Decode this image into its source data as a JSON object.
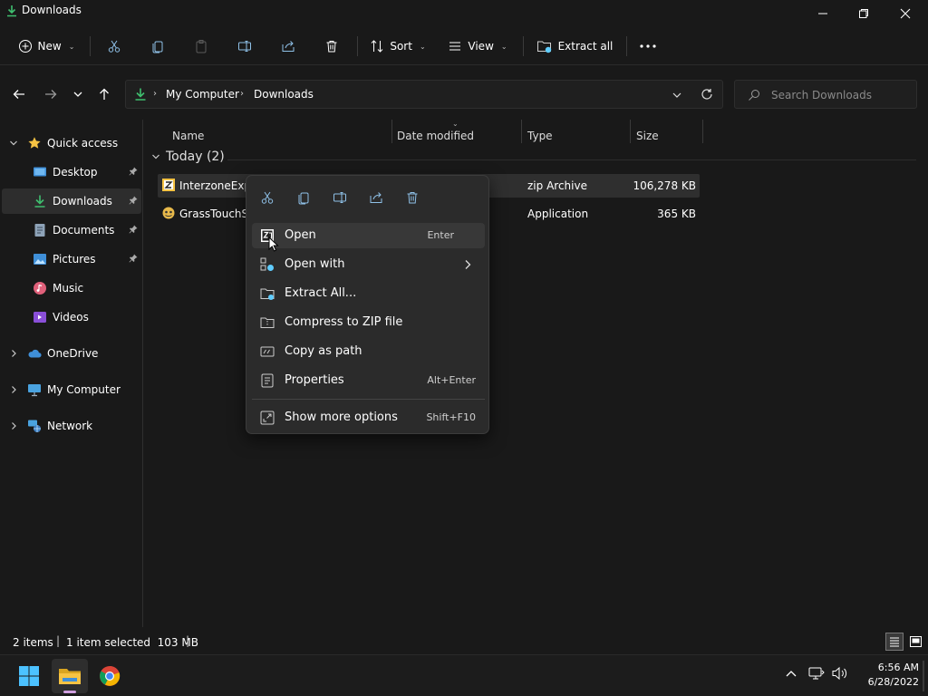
{
  "window": {
    "title": "Downloads"
  },
  "toolbar": {
    "new_label": "New",
    "sort_label": "Sort",
    "view_label": "View",
    "extract_label": "Extract all"
  },
  "address": {
    "crumbs": [
      "My Computer",
      "Downloads"
    ],
    "search_placeholder": "Search Downloads"
  },
  "sidebar": {
    "quick_access": "Quick access",
    "items": [
      {
        "label": "Desktop"
      },
      {
        "label": "Downloads"
      },
      {
        "label": "Documents"
      },
      {
        "label": "Pictures"
      },
      {
        "label": "Music"
      },
      {
        "label": "Videos"
      }
    ],
    "onedrive": "OneDrive",
    "my_computer": "My Computer",
    "network": "Network"
  },
  "list": {
    "columns": {
      "name": "Name",
      "date": "Date modified",
      "type": "Type",
      "size": "Size"
    },
    "group": "Today (2)",
    "rows": [
      {
        "name": "InterzoneExpl",
        "type": "zip Archive",
        "size": "106,278 KB"
      },
      {
        "name": "GrassTouchSir",
        "type": "Application",
        "size": "365 KB"
      }
    ]
  },
  "context_menu": {
    "items": [
      {
        "label": "Open",
        "shortcut": "Enter"
      },
      {
        "label": "Open with"
      },
      {
        "label": "Extract All..."
      },
      {
        "label": "Compress to ZIP file"
      },
      {
        "label": "Copy as path"
      },
      {
        "label": "Properties",
        "shortcut": "Alt+Enter"
      },
      {
        "label": "Show more options",
        "shortcut": "Shift+F10"
      }
    ]
  },
  "status": {
    "count": "2 items",
    "selection": "1 item selected  103 MB"
  },
  "taskbar": {
    "time": "6:56 AM",
    "date": "6/28/2022"
  },
  "colors": {
    "accent": "#60cdff",
    "folder": "#f6c343",
    "download_green": "#3fbf6f"
  }
}
